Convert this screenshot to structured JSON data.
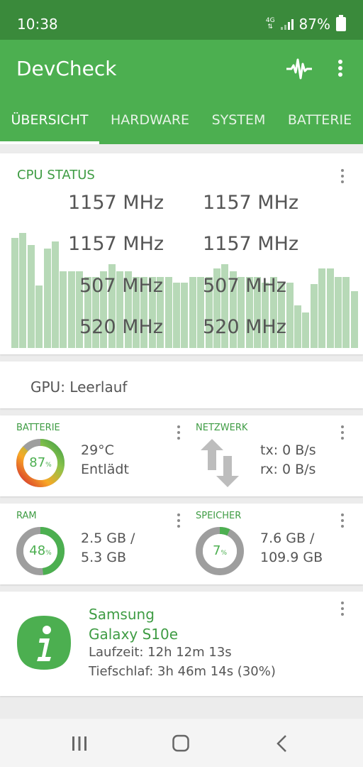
{
  "status_bar": {
    "time": "10:38",
    "network": "4G",
    "battery": "87%"
  },
  "app": {
    "title": "DevCheck",
    "pulse_icon": "pulse-icon",
    "menu_icon": "more-vert-icon"
  },
  "tabs": [
    "ÜBERSICHT",
    "HARDWARE",
    "SYSTEM",
    "BATTERIE"
  ],
  "cpu": {
    "title": "CPU STATUS",
    "frequencies": [
      "1157 MHz",
      "1157 MHz",
      "1157 MHz",
      "1157 MHz",
      "507 MHz",
      "507 MHz",
      "520 MHz",
      "520 MHz"
    ]
  },
  "gpu": {
    "text": "GPU: Leerlauf"
  },
  "battery": {
    "label": "BATTERIE",
    "percent": 87,
    "percent_text": "87",
    "percent_unit": "%",
    "temperature": "29°C",
    "state": "Entlädt"
  },
  "network": {
    "label": "NETZWERK",
    "tx": "tx: 0 B/s",
    "rx": "rx: 0 B/s"
  },
  "ram": {
    "label": "RAM",
    "percent": 48,
    "percent_text": "48",
    "percent_unit": "%",
    "line1": "2.5 GB /",
    "line2": "5.3 GB"
  },
  "storage": {
    "label": "SPEICHER",
    "percent": 7,
    "percent_text": "7",
    "percent_unit": "%",
    "line1": "7.6 GB /",
    "line2": "109.9 GB"
  },
  "device": {
    "name_line1": "Samsung",
    "name_line2": "Galaxy S10e",
    "uptime": "Laufzeit: 12h 12m 13s",
    "deep_sleep": "Tiefschlaf: 3h 46m 14s (30%)"
  },
  "colors": {
    "primary": "#4caf50",
    "primary_dark": "#3a8a3b",
    "accent_text": "#3f9c44",
    "bar": "#b7d9b7"
  }
}
